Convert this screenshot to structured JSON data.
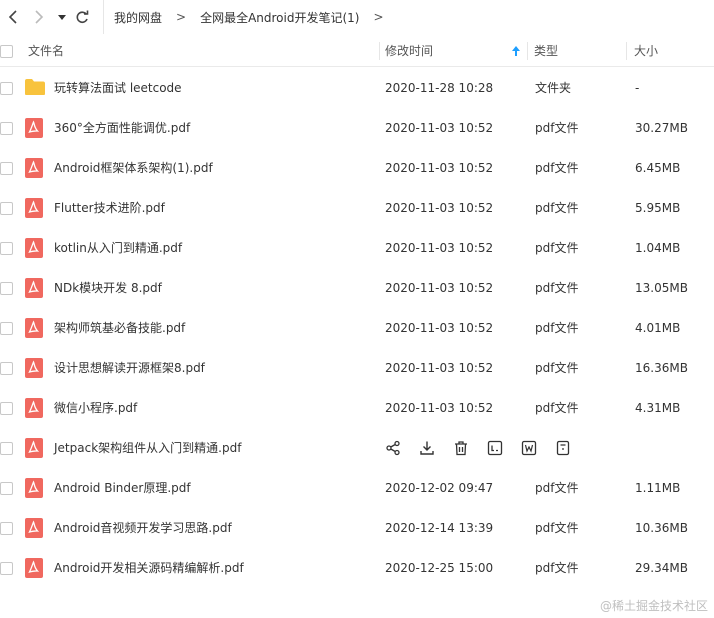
{
  "nav": {
    "back_icon": "chevron-left-icon",
    "forward_icon": "chevron-right-icon",
    "dropdown_icon": "caret-down-icon",
    "refresh_icon": "refresh-icon"
  },
  "breadcrumb": {
    "items": [
      "我的网盘",
      "全网最全Android开发笔记(1)"
    ],
    "separator": ">"
  },
  "columns": {
    "name": "文件名",
    "modified": "修改时间",
    "type": "类型",
    "size": "大小",
    "sort_icon": "arrow-up-icon",
    "sort_color": "#1e9fff"
  },
  "colors": {
    "pdf_icon": "#f0685f",
    "folder_icon": "#f8c33d"
  },
  "rows": [
    {
      "name": "玩转算法面试 leetcode",
      "modified": "2020-11-28 10:28",
      "type": "文件夹",
      "size": "-",
      "kind": "folder"
    },
    {
      "name": "360°全方面性能调优.pdf",
      "modified": "2020-11-03 10:52",
      "type": "pdf文件",
      "size": "30.27MB",
      "kind": "pdf"
    },
    {
      "name": "Android框架体系架构(1).pdf",
      "modified": "2020-11-03 10:52",
      "type": "pdf文件",
      "size": "6.45MB",
      "kind": "pdf"
    },
    {
      "name": "Flutter技术进阶.pdf",
      "modified": "2020-11-03 10:52",
      "type": "pdf文件",
      "size": "5.95MB",
      "kind": "pdf"
    },
    {
      "name": "kotlin从入门到精通.pdf",
      "modified": "2020-11-03 10:52",
      "type": "pdf文件",
      "size": "1.04MB",
      "kind": "pdf"
    },
    {
      "name": "NDk模块开发    8.pdf",
      "modified": "2020-11-03 10:52",
      "type": "pdf文件",
      "size": "13.05MB",
      "kind": "pdf"
    },
    {
      "name": "架构师筑基必备技能.pdf",
      "modified": "2020-11-03 10:52",
      "type": "pdf文件",
      "size": "4.01MB",
      "kind": "pdf"
    },
    {
      "name": "设计思想解读开源框架8.pdf",
      "modified": "2020-11-03 10:52",
      "type": "pdf文件",
      "size": "16.36MB",
      "kind": "pdf"
    },
    {
      "name": "微信小程序.pdf",
      "modified": "2020-11-03 10:52",
      "type": "pdf文件",
      "size": "4.31MB",
      "kind": "pdf"
    },
    {
      "name": "Jetpack架构组件从入门到精通.pdf",
      "modified": "",
      "type": "",
      "size": "",
      "kind": "pdf",
      "hover": true
    },
    {
      "name": "Android Binder原理.pdf",
      "modified": "2020-12-02 09:47",
      "type": "pdf文件",
      "size": "1.11MB",
      "kind": "pdf"
    },
    {
      "name": "Android音视频开发学习思路.pdf",
      "modified": "2020-12-14 13:39",
      "type": "pdf文件",
      "size": "10.36MB",
      "kind": "pdf"
    },
    {
      "name": "Android开发相关源码精编解析.pdf",
      "modified": "2020-12-25 15:00",
      "type": "pdf文件",
      "size": "29.34MB",
      "kind": "pdf"
    }
  ],
  "hover_actions": [
    "share-icon",
    "download-icon",
    "delete-icon",
    "open-text-icon",
    "open-word-icon",
    "more-icon"
  ],
  "watermark": "@稀土掘金技术社区"
}
